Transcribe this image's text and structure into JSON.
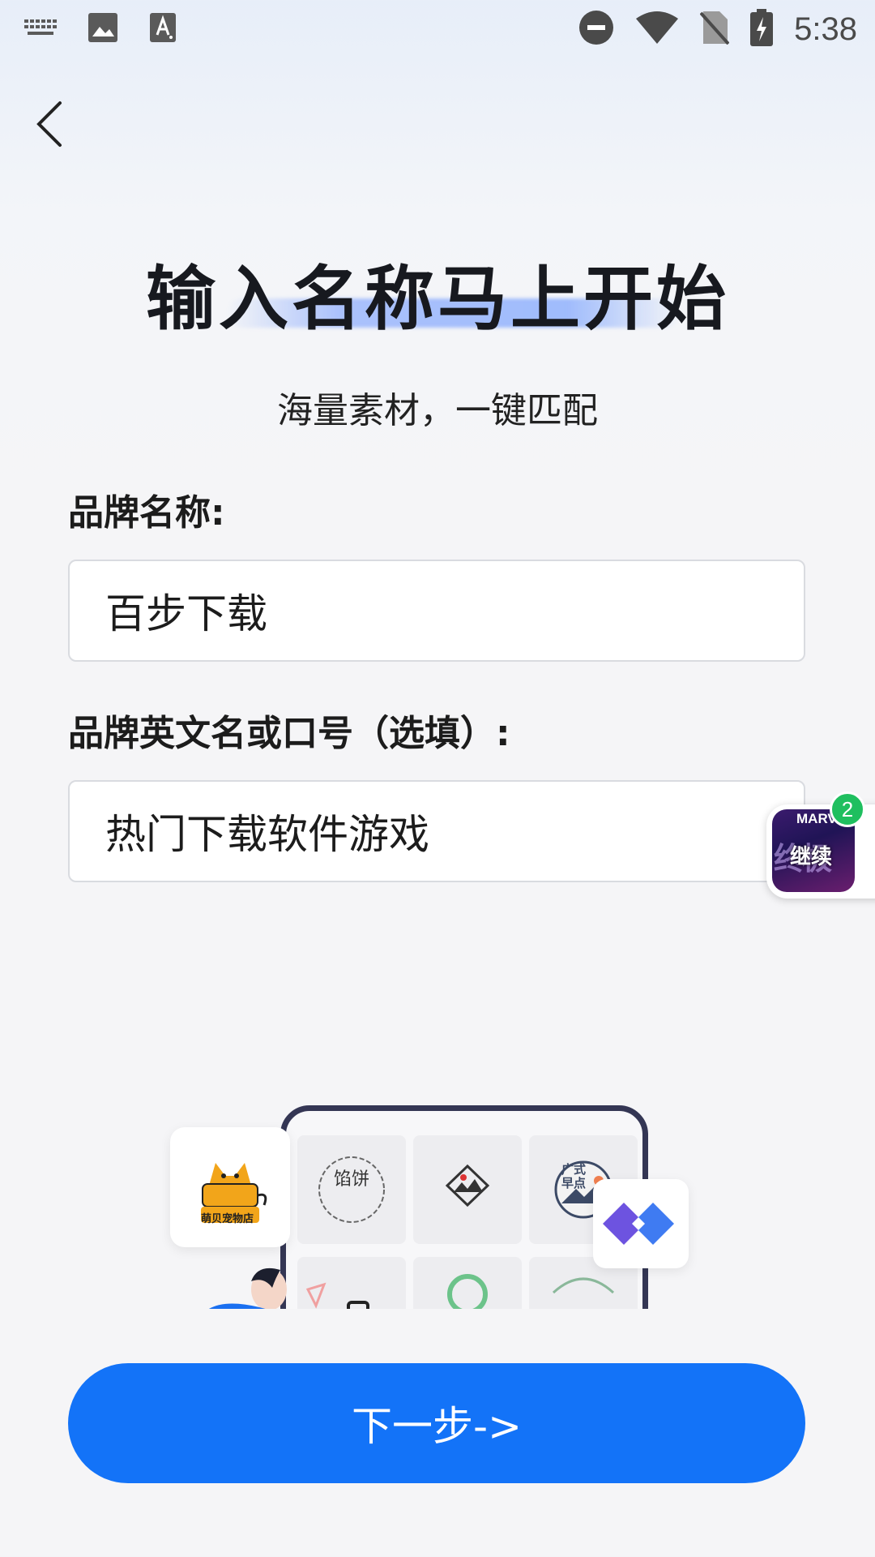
{
  "status_bar": {
    "time": "5:38",
    "left_icons": [
      "keyboard-icon",
      "image-icon",
      "font-icon"
    ],
    "right_icons": [
      "do-not-disturb-icon",
      "wifi-icon",
      "no-sim-icon",
      "battery-charging-icon"
    ]
  },
  "nav": {
    "back_icon": "chevron-left-icon"
  },
  "hero": {
    "title": "输入名称马上开始",
    "subtitle": "海量素材，一键匹配"
  },
  "form": {
    "brand_name_label": "品牌名称:",
    "brand_name_value": "百步下载",
    "brand_slogan_label": "品牌英文名或口号（选填）:",
    "brand_slogan_value": "热门下载软件游戏"
  },
  "floating_widget": {
    "badge_count": "2",
    "brand_text": "MARVEL",
    "title_text": "终极",
    "continue_text": "继续"
  },
  "illustration": {
    "pet_store_label": "萌贝宠物店",
    "tile1_text": "馅饼",
    "tile3_text": "广式早点"
  },
  "footer": {
    "next_button_label": "下一步->"
  },
  "colors": {
    "primary": "#1373f8",
    "badge": "#1fbf5f",
    "title": "#17191f"
  }
}
